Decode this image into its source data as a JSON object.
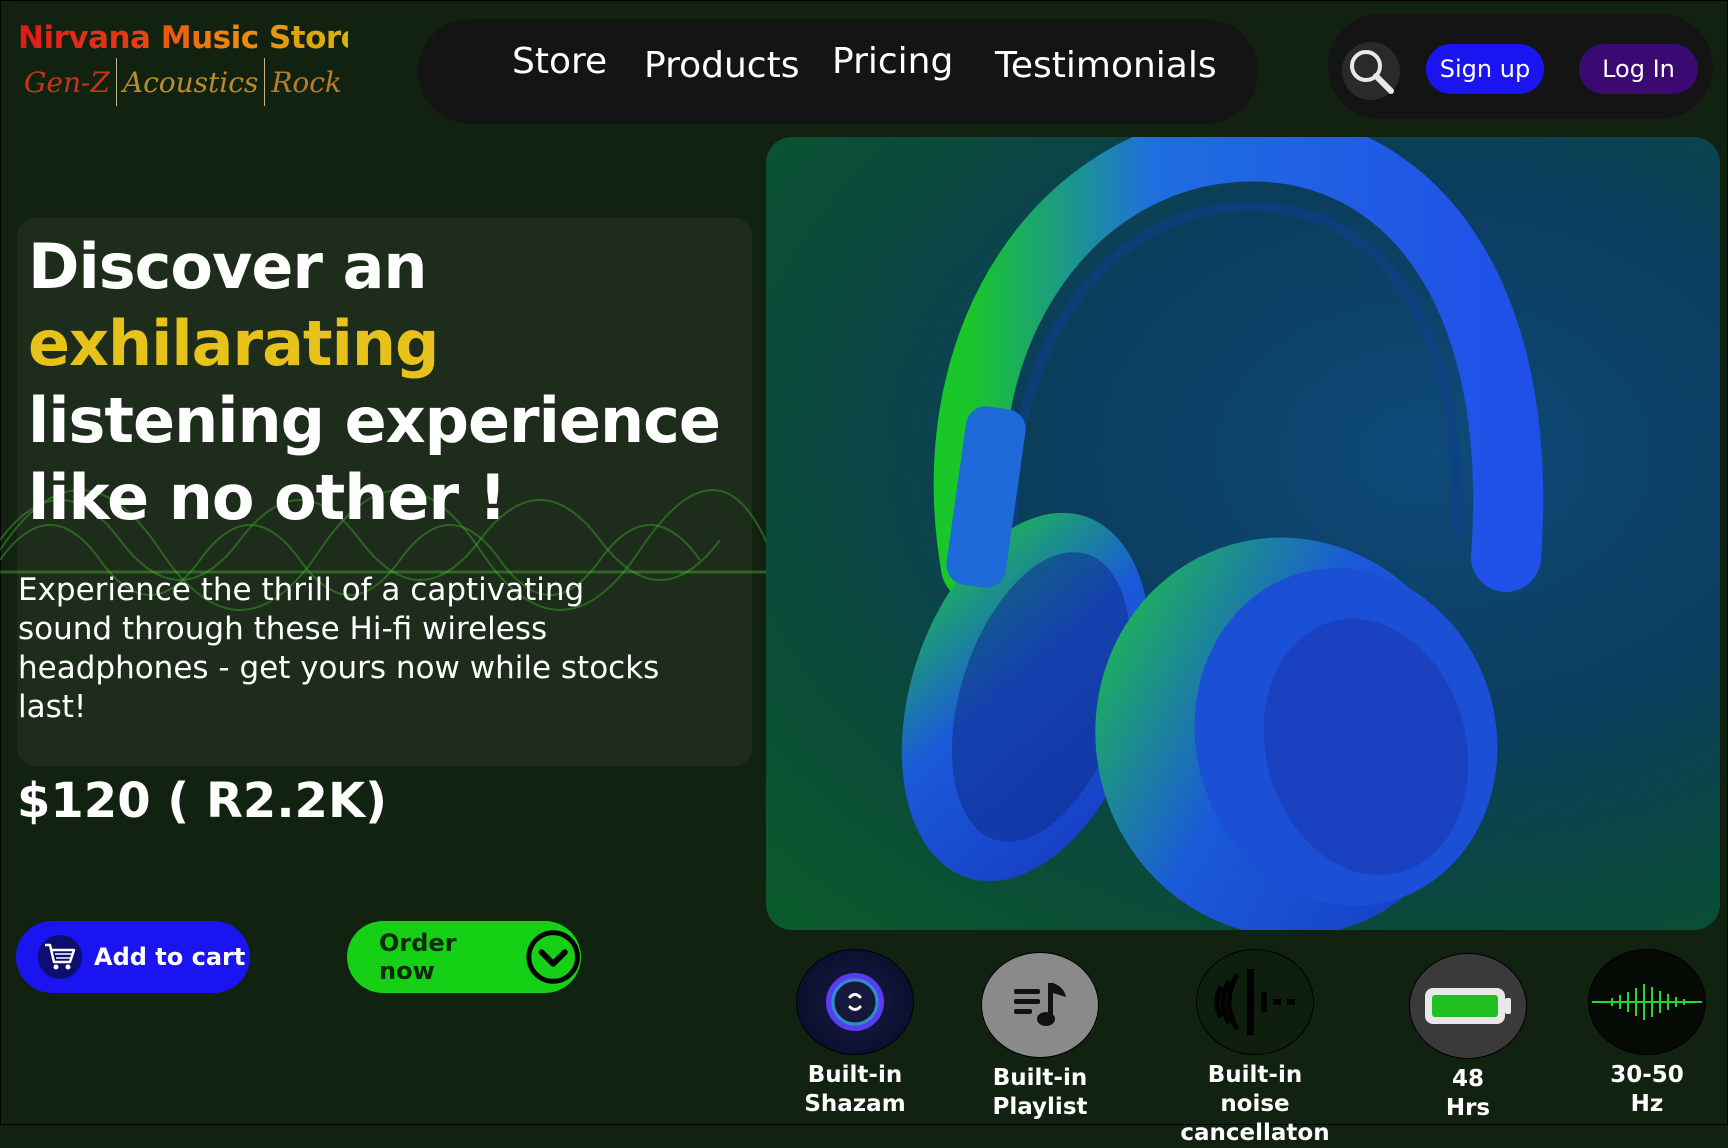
{
  "brand": {
    "title": "Nirvana Music Store",
    "tags": [
      "Gen-Z",
      "Acoustics",
      "Rock"
    ]
  },
  "nav": {
    "items": [
      "Store",
      "Products",
      "Pricing",
      "Testimonials"
    ]
  },
  "auth": {
    "signup_label": "Sign up",
    "login_label": "Log In"
  },
  "hero": {
    "headline_line1": "Discover an",
    "headline_highlight": "exhilarating",
    "headline_line3": "listening experience",
    "headline_line4": "like no other !",
    "subtext": "Experience the thrill of a captivating sound through these Hi-fi wireless headphones - get yours now while stocks last!",
    "price": "$120 ( R2.2K)",
    "add_to_cart_label": "Add to cart",
    "order_now_label": "Order now"
  },
  "features": [
    {
      "icon": "shazam-icon",
      "label_line1": "Built-in",
      "label_line2": "Shazam"
    },
    {
      "icon": "playlist-icon",
      "label_line1": "Built-in",
      "label_line2": "Playlist"
    },
    {
      "icon": "noise-cancellation-icon",
      "label_line1": "Built-in noise",
      "label_line2": "cancellaton"
    },
    {
      "icon": "battery-icon",
      "label_line1": "48",
      "label_line2": "Hrs"
    },
    {
      "icon": "frequency-wave-icon",
      "label_line1": "30-50",
      "label_line2": "Hz"
    }
  ],
  "colors": {
    "background": "#112310",
    "highlight": "#e7c21a",
    "signup": "#1a15f0",
    "login": "#3a0a72",
    "order": "#16d016"
  }
}
